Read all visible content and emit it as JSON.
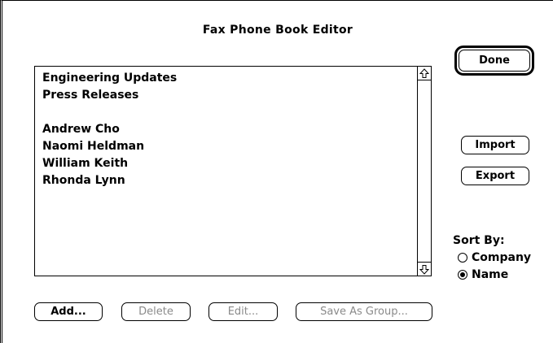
{
  "dialog": {
    "title": "Fax Phone Book Editor"
  },
  "list": {
    "items": [
      "Engineering Updates",
      "Press Releases",
      "",
      "Andrew Cho",
      "Naomi Heldman",
      "William Keith",
      "Rhonda Lynn"
    ]
  },
  "buttons": {
    "done": "Done",
    "import": "Import",
    "export": "Export",
    "add": "Add...",
    "delete": "Delete",
    "edit": "Edit...",
    "save_as_group": "Save As Group..."
  },
  "sort": {
    "label": "Sort By:",
    "options": [
      {
        "label": "Company",
        "checked": false
      },
      {
        "label": "Name",
        "checked": true
      }
    ]
  }
}
